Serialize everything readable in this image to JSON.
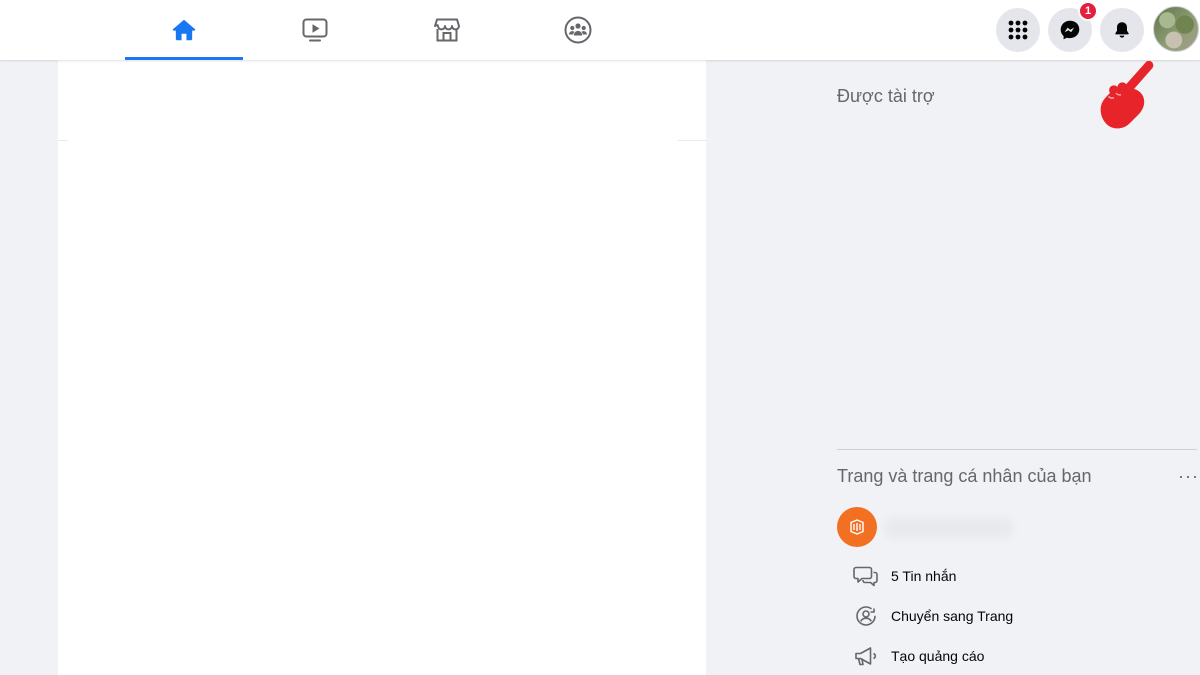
{
  "nav": {
    "tabs": [
      {
        "name": "home",
        "icon": "home-icon",
        "active": true
      },
      {
        "name": "watch",
        "icon": "video-icon",
        "active": false
      },
      {
        "name": "marketplace",
        "icon": "store-icon",
        "active": false
      },
      {
        "name": "groups",
        "icon": "groups-icon",
        "active": false
      }
    ],
    "accent_color": "#1877f2"
  },
  "header_actions": {
    "menu_icon": "grid-menu-icon",
    "messenger_icon": "messenger-icon",
    "messenger_badge": "1",
    "notifications_icon": "bell-icon",
    "avatar": "profile-avatar"
  },
  "sidebar_right": {
    "sponsored_title": "Được tài trợ",
    "pages_section": {
      "title": "Trang và trang cá nhân của bạn",
      "more": "···",
      "page_avatar_color": "#f36f21",
      "actions": [
        {
          "icon": "message-icon",
          "label": "5 Tin nhắn"
        },
        {
          "icon": "switch-profile-icon",
          "label": "Chuyển sang Trang"
        },
        {
          "icon": "megaphone-icon",
          "label": "Tạo quảng cáo"
        }
      ]
    }
  },
  "overlay": {
    "pointer_color": "#e8242b"
  }
}
